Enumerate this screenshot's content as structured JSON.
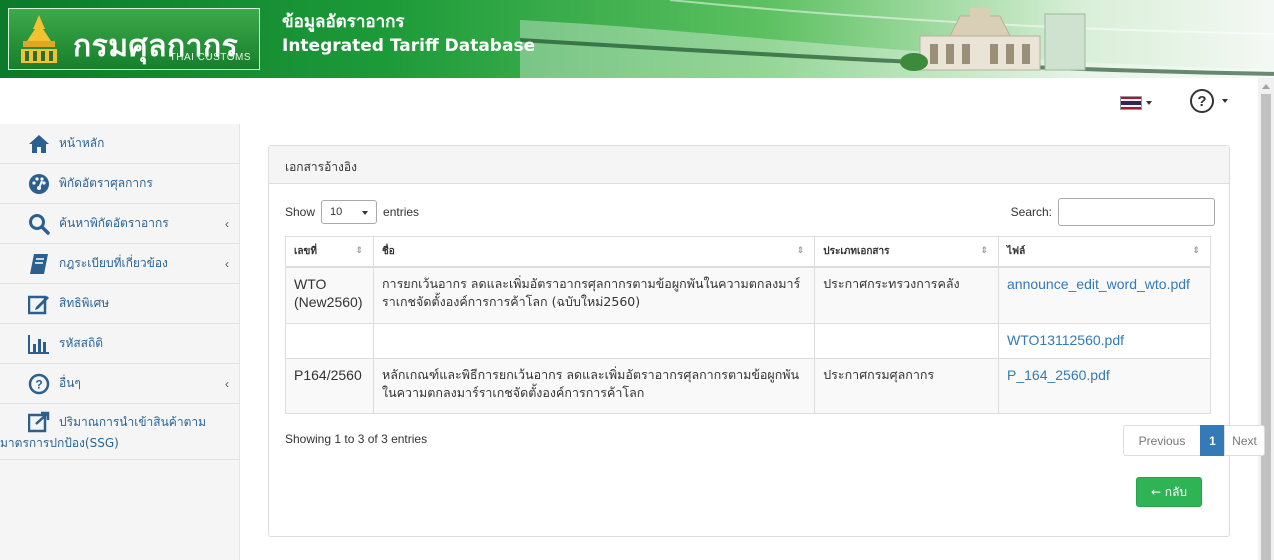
{
  "header": {
    "logo_name": "กรมศุลกากร",
    "logo_sub": "THAI CUSTOMS",
    "site_title": "ข้อมูลอัตราอากร",
    "site_subtitle": "Integrated Tariff Database"
  },
  "topbar": {
    "flag_icon": "thai-flag-icon",
    "help_icon": "question-circle-icon",
    "flag_colors": [
      "#a51931",
      "#f4f5f8",
      "#2d2a4a",
      "#f4f5f8",
      "#a51931"
    ]
  },
  "sidebar": {
    "items": [
      {
        "label": "หน้าหลัก",
        "icon": "home-icon",
        "has_submenu": false
      },
      {
        "label": "พิกัดอัตราศุลกากร",
        "icon": "dashboard-icon",
        "has_submenu": false
      },
      {
        "label": "ค้นหาพิกัดอัตราอากร",
        "icon": "search-icon",
        "has_submenu": true
      },
      {
        "label": "กฎระเบียบที่เกี่ยวข้อง",
        "icon": "book-icon",
        "has_submenu": true
      },
      {
        "label": "สิทธิพิเศษ",
        "icon": "edit-icon",
        "has_submenu": false
      },
      {
        "label": "รหัสสถิติ",
        "icon": "bar-chart-icon",
        "has_submenu": false
      },
      {
        "label": "อื่นๆ",
        "icon": "question-circle-icon",
        "has_submenu": true
      },
      {
        "label_line1": "ปริมาณการนำเข้าสินค้าตาม",
        "label_line2": "มาตรการปกป้อง(SSG)",
        "icon": "external-link-icon",
        "has_submenu": false
      }
    ],
    "chevron": "‹"
  },
  "panel": {
    "heading": "เอกสารอ้างอิง",
    "show_label": "Show",
    "entries_value": "10",
    "entries_label": "entries",
    "search_label": "Search:",
    "search_value": "",
    "columns": [
      "เลขที่",
      "ชื่อ",
      "ประเภทเอกสาร",
      "ไฟล์"
    ],
    "rows": [
      {
        "no": "WTO (New2560)",
        "name": "การยกเว้นอากร ลดและเพิ่มอัตราอากรศุลกากรตามข้อผูกพันในความตกลงมาร์ราเกชจัดตั้งองค์การการค้าโลก (ฉบับใหม่2560)",
        "type": "ประกาศกระทรวงการคลัง",
        "file": "announce_edit_word_wto.pdf"
      },
      {
        "no": "",
        "name": "",
        "type": "",
        "file": "WTO13112560.pdf"
      },
      {
        "no": "P164/2560",
        "name": "หลักเกณฑ์และพิธีการยกเว้นอากร ลดและเพิ่มอัตราอากรศุลกากรตามข้อผูกพันในความตกลงมาร์ราเกชจัดตั้งองค์การการค้าโลก",
        "type": "ประกาศกรมศุลกากร",
        "file": "P_164_2560.pdf"
      }
    ],
    "info": "Showing 1 to 3 of 3 entries",
    "pagination": {
      "previous": "Previous",
      "current": "1",
      "next": "Next"
    },
    "back_label": "← กลับ"
  }
}
